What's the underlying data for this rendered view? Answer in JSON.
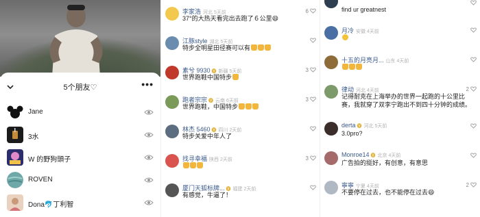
{
  "friends_panel": {
    "title": "5个朋友♡",
    "more": "•••",
    "friends": [
      {
        "name": "Jane",
        "avatar": "mickey-icon"
      },
      {
        "name": "3水",
        "avatar": "cup-avatar"
      },
      {
        "name": "W 的野狗頭子",
        "avatar": "art-avatar"
      },
      {
        "name": "ROVEN",
        "avatar": "planet-avatar"
      },
      {
        "name": "Dona🐬丁利智",
        "avatar": "photo-avatar"
      }
    ]
  },
  "comments_middle": [
    {
      "user": "李家浩",
      "meta": "河北 5天前",
      "badge": "",
      "text": "37°的大热天看完出去跑了６公里😄",
      "likes": "6",
      "avatar_color": "#f2c94c"
    },
    {
      "user": "江豚style",
      "meta": "湖北 5天前",
      "badge": "",
      "text": "特步全明星田径赛可以有",
      "likes": "",
      "avatar_color": "#6a8caf"
    },
    {
      "user": "素兮 9930",
      "meta": "新疆 5天前",
      "badge": "🅥",
      "text": "世界跑鞋中国特步",
      "likes": "3",
      "avatar_color": "#c0392b"
    },
    {
      "user": "跑者宗宗",
      "meta": "云南 6天前",
      "badge": "🅥",
      "text": "世界跑鞋，中国特步",
      "likes": "3",
      "avatar_color": "#7a9a5a"
    },
    {
      "user": "林杰 5460",
      "meta": "四川 2天前",
      "badge": "🅥",
      "text": "特步关爱中年人了",
      "likes": "",
      "avatar_color": "#5b6d7e"
    },
    {
      "user": "找寻幸福",
      "meta": "陕西 2天前",
      "badge": "",
      "text": "",
      "likes": "3",
      "avatar_color": "#d9534f"
    },
    {
      "user": "厦门天狐标牌...",
      "meta": "福建 2天前",
      "badge": "🅥",
      "text": "有感觉，牛逼了！",
      "likes": "",
      "avatar_color": "#555555"
    }
  ],
  "comments_right": [
    {
      "user": "",
      "meta": "",
      "text": "find ur greatnest",
      "likes": "",
      "avatar_color": "#2c3e50"
    },
    {
      "user": "月冷",
      "meta": "安徽 4天前",
      "text": "",
      "likes": "",
      "avatar_color": "#4a6fa5"
    },
    {
      "user": "十五的月亮月...",
      "meta": "山东 4天前",
      "text": "",
      "likes": "",
      "avatar_color": "#8e6c3a"
    },
    {
      "user": "律动",
      "meta": "河北 4天前",
      "text": "记得耐克在上海举办的世界一起跑的十公里比赛，我就穿了双李宁跑出不到四十分钟的成绩。",
      "likes": "2",
      "avatar_color": "#7d9b6a"
    },
    {
      "user": "derta",
      "meta": "河北 5天前",
      "badge": "🅥",
      "text": "3.0pro?",
      "likes": "",
      "avatar_color": "#3b2e2a"
    },
    {
      "user": "Monroe14",
      "meta": "北京 4天前",
      "badge": "🅥",
      "text": "广告拍的挺好，有创意，有意思",
      "likes": "",
      "avatar_color": "#a56a6a"
    },
    {
      "user": "寧寧",
      "meta": "宁夏 4天前",
      "text": "不要停在过去，也不能停在过去😄",
      "likes": "2",
      "avatar_color": "#b0b8c4"
    }
  ],
  "colors": {
    "username": "#3a5a8c",
    "meta": "#b0b0b0",
    "badge": "#e0b23a"
  }
}
